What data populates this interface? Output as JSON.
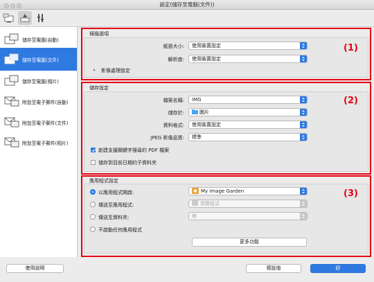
{
  "window": {
    "title": "設定(儲存至電腦(文件))"
  },
  "sidebar": {
    "items": [
      {
        "label": "儲存至電腦(自動)"
      },
      {
        "label": "儲存至電腦(文件)"
      },
      {
        "label": "儲存至電腦(相片)"
      },
      {
        "label": "附加至電子郵件(自動)"
      },
      {
        "label": "附加至電子郵件(文件)"
      },
      {
        "label": "附加至電子郵件(相片)"
      }
    ],
    "selected_index": 1
  },
  "scan_options": {
    "title": "掃描選項",
    "number_label": "(1)",
    "paper_size_label": "紙張大小:",
    "paper_size_value": "使用裝置設定",
    "resolution_label": "解析度:",
    "resolution_value": "使用裝置設定",
    "image_processing_label": "影像處理設定"
  },
  "save_settings": {
    "title": "儲存設定",
    "number_label": "(2)",
    "file_name_label": "檔案名稱:",
    "file_name_value": "IMG",
    "save_in_label": "儲存於:",
    "save_in_value": "圖片",
    "data_format_label": "資料格式:",
    "data_format_value": "使用裝置設定",
    "jpeg_quality_label": "JPEG 影像品質:",
    "jpeg_quality_value": "標準",
    "pdf_keyword_label": "創建支援關鍵字搜尋的 PDF 檔案",
    "pdf_keyword_checked": true,
    "subfolder_label": "儲存到目前日期的子資料夾",
    "subfolder_checked": false
  },
  "app_settings": {
    "title": "應用程式設定",
    "number_label": "(3)",
    "open_with_label": "以應用程式開啟:",
    "open_with_value": "My Image Garden",
    "send_to_app_label": "傳送至應用程式:",
    "send_to_app_value": "預覽程式",
    "send_to_folder_label": "傳送至資料夾:",
    "send_to_folder_value": "無",
    "do_not_start_label": "不啟動任何應用程式",
    "more_functions_label": "更多功能",
    "selected_option": "open_with"
  },
  "footer": {
    "help_label": "使用說明",
    "defaults_label": "預設值",
    "ok_label": "好"
  },
  "colors": {
    "accent": "#2f7ae0",
    "highlight": "#e60012"
  }
}
